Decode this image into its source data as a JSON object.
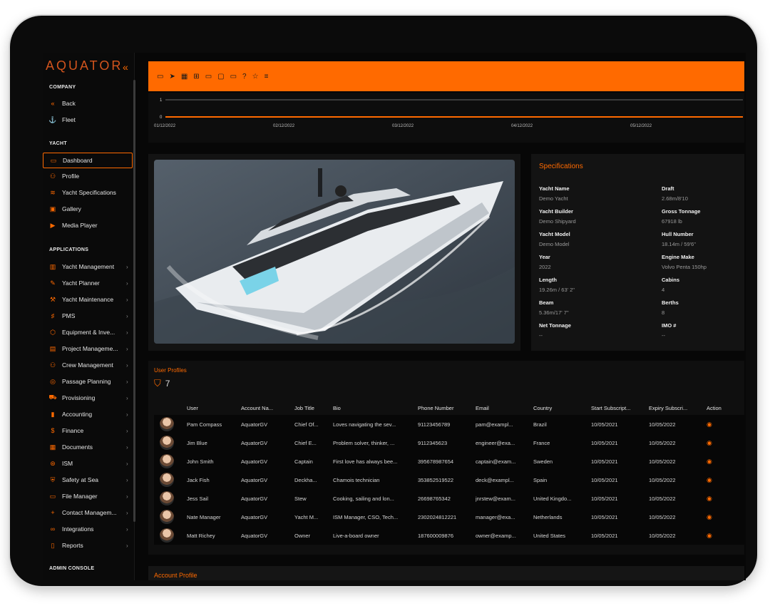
{
  "brand": {
    "logo": "AQUATOR",
    "collapse_icon": "«"
  },
  "sidebar": {
    "sections": {
      "company": "COMPANY",
      "yacht": "YACHT",
      "applications": "APPLICATIONS",
      "admin": "ADMIN CONSOLE"
    },
    "company_items": [
      {
        "label": "Back",
        "icon": "«"
      },
      {
        "label": "Fleet",
        "icon": "⚓"
      }
    ],
    "yacht_items": [
      {
        "label": "Dashboard",
        "icon": "▭"
      },
      {
        "label": "Profile",
        "icon": "⚇"
      },
      {
        "label": "Yacht Specifications",
        "icon": "≋"
      },
      {
        "label": "Gallery",
        "icon": "▣"
      },
      {
        "label": "Media Player",
        "icon": "▶"
      }
    ],
    "app_items": [
      {
        "label": "Yacht Management",
        "icon": "▥"
      },
      {
        "label": "Yacht Planner",
        "icon": "✎"
      },
      {
        "label": "Yacht Maintenance",
        "icon": "⚒"
      },
      {
        "label": "PMS",
        "icon": "♯"
      },
      {
        "label": "Equipment & Inve...",
        "icon": "⬡"
      },
      {
        "label": "Project Manageme...",
        "icon": "▤"
      },
      {
        "label": "Crew Management",
        "icon": "⚇"
      },
      {
        "label": "Passage Planning",
        "icon": "◎"
      },
      {
        "label": "Provisioning",
        "icon": "⛟"
      },
      {
        "label": "Accounting",
        "icon": "▮"
      },
      {
        "label": "Finance",
        "icon": "$"
      },
      {
        "label": "Documents",
        "icon": "▦"
      },
      {
        "label": "ISM",
        "icon": "⊛"
      },
      {
        "label": "Safety at Sea",
        "icon": "⛨"
      },
      {
        "label": "File Manager",
        "icon": "▭"
      },
      {
        "label": "Contact Managem...",
        "icon": "+"
      },
      {
        "label": "Integrations",
        "icon": "∞"
      },
      {
        "label": "Reports",
        "icon": "▯"
      }
    ],
    "chevron": "›"
  },
  "toolbar": {
    "icons": [
      "▭",
      "➤",
      "▦",
      "⊞",
      "▭",
      "▢",
      "▭",
      "?",
      "☆",
      "≡"
    ]
  },
  "timeline": {
    "y_ticks": [
      "1",
      "0"
    ],
    "x_ticks": [
      "01/12/2022",
      "02/12/2022",
      "03/12/2022",
      "04/12/2022",
      "05/12/2022"
    ]
  },
  "specifications": {
    "title": "Specifications",
    "left": [
      {
        "label": "Yacht Name",
        "value": "Demo Yacht"
      },
      {
        "label": "Yacht Builder",
        "value": "Demo Shipyard"
      },
      {
        "label": "Yacht Model",
        "value": "Demo Model"
      },
      {
        "label": "Year",
        "value": "2022"
      },
      {
        "label": "Length",
        "value": "19.26m / 63' 2\""
      },
      {
        "label": "Beam",
        "value": "5.36m/17' 7\""
      },
      {
        "label": "Net Tonnage",
        "value": "--"
      }
    ],
    "right": [
      {
        "label": "Draft",
        "value": "2.68m/8'10"
      },
      {
        "label": "Gross Tonnage",
        "value": "67918 lb"
      },
      {
        "label": "Hull Number",
        "value": "18.14m / 59'6\""
      },
      {
        "label": "Engine Make",
        "value": "Volvo Penta 150hp"
      },
      {
        "label": "Cabins",
        "value": "4"
      },
      {
        "label": "Berths",
        "value": "8"
      },
      {
        "label": "IMO #",
        "value": "--"
      }
    ]
  },
  "users": {
    "title": "User Profiles",
    "count": "7",
    "headers": [
      "User",
      "Account Na...",
      "Job Title",
      "Bio",
      "Phone Number",
      "Email",
      "Country",
      "Start Subscript...",
      "Expiry Subscri...",
      "Action"
    ],
    "rows": [
      [
        "Pam Compass",
        "AquatorGV",
        "Chief Of...",
        "Loves navigating the sev...",
        "91123456789",
        "pam@exampl...",
        "Brazil",
        "10/05/2021",
        "10/05/2022"
      ],
      [
        "Jim Blue",
        "AquatorGV",
        "Chief E...",
        "Problem solver, thinker, ...",
        "9112345623",
        "engineer@exa...",
        "France",
        "10/05/2021",
        "10/05/2022"
      ],
      [
        "John Smith",
        "AquatorGV",
        "Captain",
        "First love has always bee...",
        "395678987654",
        "captain@exam...",
        "Sweden",
        "10/05/2021",
        "10/05/2022"
      ],
      [
        "Jack Fish",
        "AquatorGV",
        "Deckha...",
        "Chamois technician",
        "353852519522",
        "deck@exampl...",
        "Spain",
        "10/05/2021",
        "10/05/2022"
      ],
      [
        "Jess Sail",
        "AquatorGV",
        "Stew",
        "Cooking, sailing and lon...",
        "26698765342",
        "jnrstew@exam...",
        "United Kingdo...",
        "10/05/2021",
        "10/05/2022"
      ],
      [
        "Nate Manager",
        "AquatorGV",
        "Yacht M...",
        "ISM Manager, CSO, Tech...",
        "2302024812221",
        "manager@exa...",
        "Netherlands",
        "10/05/2021",
        "10/05/2022"
      ],
      [
        "Matt Richey",
        "AquatorGV",
        "Owner",
        "Live-a-board owner",
        "187600009876",
        "owner@examp...",
        "United States",
        "10/05/2021",
        "10/05/2022"
      ]
    ]
  },
  "account": {
    "title": "Account Profile"
  }
}
